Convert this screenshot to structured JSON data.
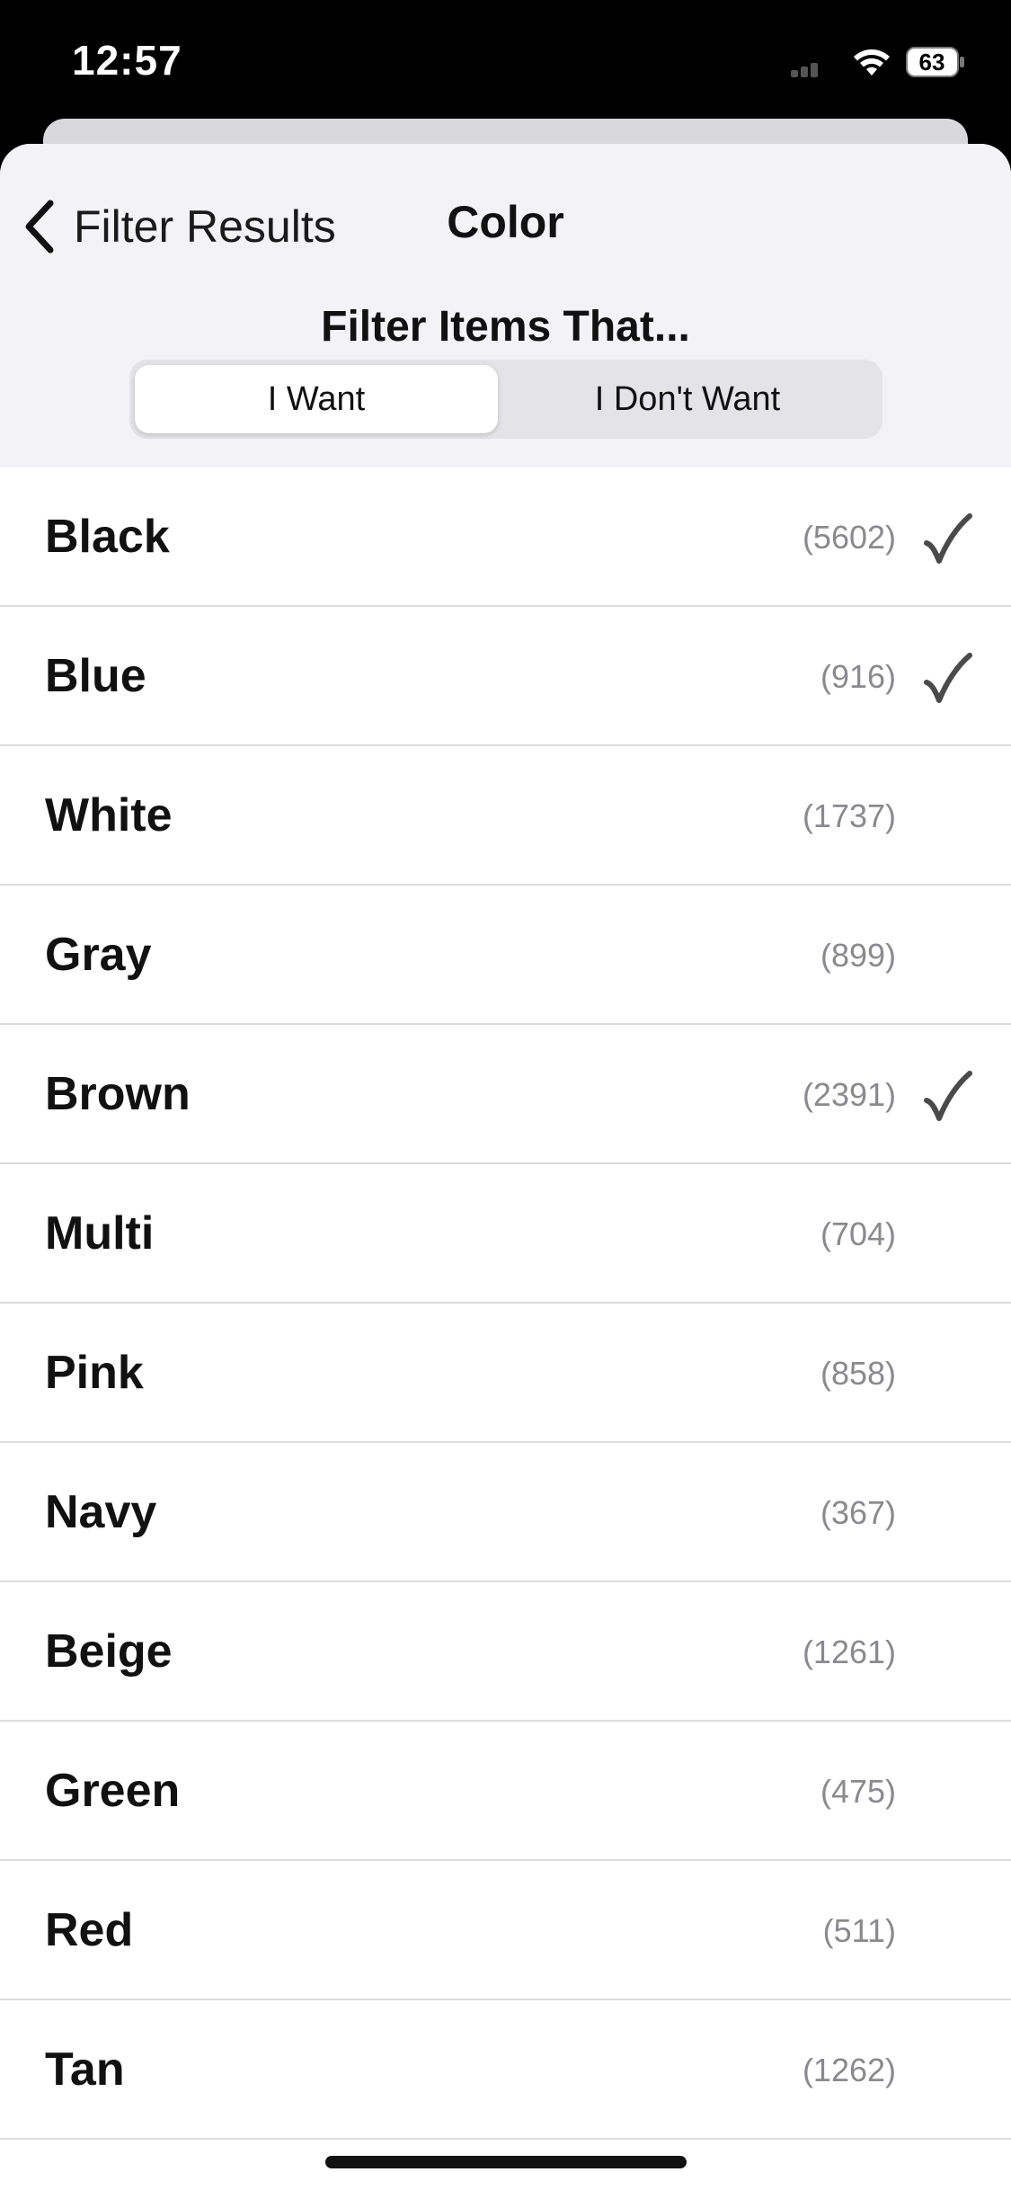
{
  "status_bar": {
    "time": "12:57",
    "battery_level": "63"
  },
  "header": {
    "back_label": "Filter Results",
    "title": "Color",
    "filter_heading": "Filter Items That...",
    "segments": [
      {
        "label": "I Want",
        "selected": true
      },
      {
        "label": "I Don't Want",
        "selected": false
      }
    ]
  },
  "colors": [
    {
      "name": "Black",
      "count": "(5602)",
      "checked": true
    },
    {
      "name": "Blue",
      "count": "(916)",
      "checked": true
    },
    {
      "name": "White",
      "count": "(1737)",
      "checked": false
    },
    {
      "name": "Gray",
      "count": "(899)",
      "checked": false
    },
    {
      "name": "Brown",
      "count": "(2391)",
      "checked": true
    },
    {
      "name": "Multi",
      "count": "(704)",
      "checked": false
    },
    {
      "name": "Pink",
      "count": "(858)",
      "checked": false
    },
    {
      "name": "Navy",
      "count": "(367)",
      "checked": false
    },
    {
      "name": "Beige",
      "count": "(1261)",
      "checked": false
    },
    {
      "name": "Green",
      "count": "(475)",
      "checked": false
    },
    {
      "name": "Red",
      "count": "(511)",
      "checked": false
    },
    {
      "name": "Tan",
      "count": "(1262)",
      "checked": false
    }
  ],
  "icons": {
    "back": "chevron-left-icon",
    "check": "checkmark-icon",
    "wifi": "wifi-icon",
    "battery": "battery-icon",
    "signal": "cellular-signal-icon"
  }
}
